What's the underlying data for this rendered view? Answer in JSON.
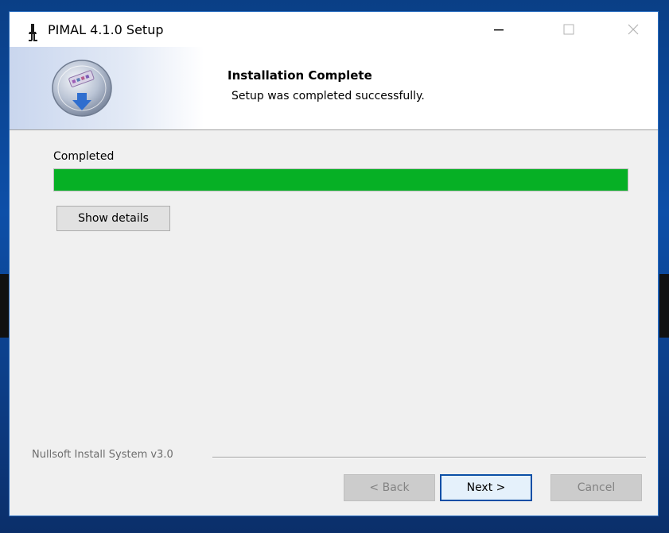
{
  "window": {
    "title": "PIMAL 4.1.0 Setup",
    "app_icon": "installer-figure-icon",
    "controls": {
      "minimize_icon": "minimize-icon",
      "maximize_icon": "maximize-icon",
      "close_icon": "close-icon"
    }
  },
  "header": {
    "title": "Installation Complete",
    "subtitle": "Setup was completed successfully.",
    "logo_icon": "install-disc-icon"
  },
  "main": {
    "status_label": "Completed",
    "progress_percent": 100,
    "progress_color": "#06b025",
    "show_details_label": "Show details"
  },
  "footer": {
    "branding": "Nullsoft Install System v3.0",
    "back_label": "< Back",
    "next_label": "Next >",
    "cancel_label": "Cancel"
  }
}
